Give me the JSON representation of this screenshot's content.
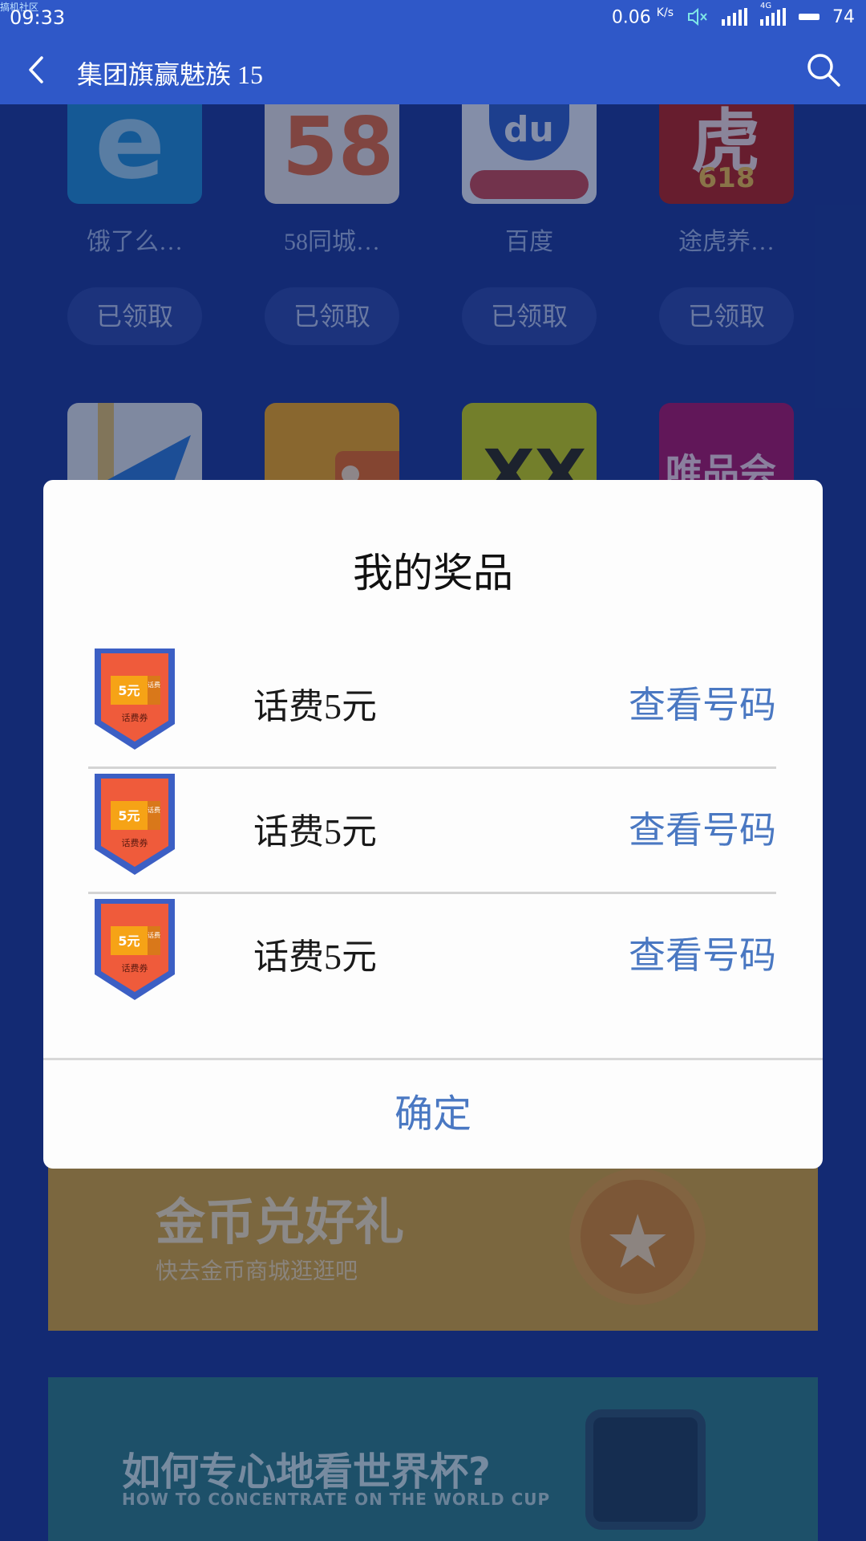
{
  "status_bar": {
    "tiny_label": "搞机社区",
    "time": "09:33",
    "speed": "0.06",
    "speed_unit": "K/s",
    "network": "4G",
    "battery": "74",
    "icons": [
      "mute-icon",
      "signal-icon",
      "signal-4g-icon",
      "battery-icon"
    ]
  },
  "app_bar": {
    "title": "集团旗赢魅族 15",
    "icons": [
      "back-icon",
      "search-icon"
    ]
  },
  "background_apps": {
    "row1": [
      {
        "name": "饿了么…",
        "button": "已领取",
        "color": "#1e8ed6"
      },
      {
        "name": "58同城…",
        "button": "已领取",
        "color": "#f4f4f4"
      },
      {
        "name": "百度",
        "button": "已领取",
        "color": "#2d7ee8"
      },
      {
        "name": "途虎养…",
        "button": "已领取",
        "color": "#c8231c"
      }
    ],
    "row2_colors": [
      "#e9eef2",
      "#f0a81c",
      "#d6e614",
      "#b5146e"
    ],
    "row2_partial_text": [
      "",
      "",
      "XX",
      "唯品会"
    ],
    "row1_icon_text": [
      "e",
      "58",
      "du",
      "虎"
    ]
  },
  "gold_banner": {
    "title": "金币兑好礼",
    "subtitle": "快去金币商城逛逛吧"
  },
  "world_banner": {
    "title": "如何专心地看世界杯?",
    "subtitle": "HOW TO CONCENTRATE ON THE WORLD CUP"
  },
  "dialog": {
    "title": "我的奖品",
    "prizes": [
      {
        "name": "话费5元",
        "action": "查看号码",
        "badge_value": "5元",
        "badge_tag": "话费",
        "badge_caption": "话费券"
      },
      {
        "name": "话费5元",
        "action": "查看号码",
        "badge_value": "5元",
        "badge_tag": "话费",
        "badge_caption": "话费券"
      },
      {
        "name": "话费5元",
        "action": "查看号码",
        "badge_value": "5元",
        "badge_tag": "话费",
        "badge_caption": "话费券"
      }
    ],
    "confirm": "确定",
    "colors": {
      "accent": "#4a78c2",
      "coupon_red": "#ef5b3b",
      "coupon_blue": "#3c5fc4",
      "coupon_gold": "#f6a316"
    }
  }
}
